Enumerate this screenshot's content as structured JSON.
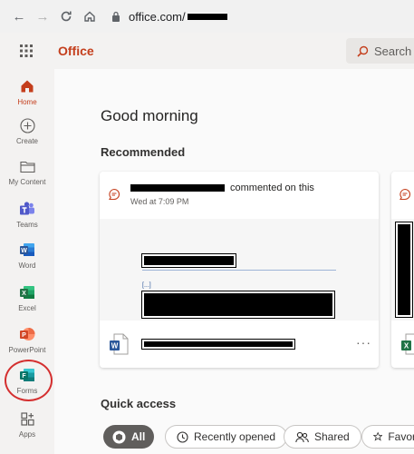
{
  "browser": {
    "url": "office.com/"
  },
  "header": {
    "brand": "Office",
    "search_placeholder": "Search"
  },
  "rail": {
    "items": [
      {
        "label": "Home"
      },
      {
        "label": "Create"
      },
      {
        "label": "My Content"
      },
      {
        "label": "Teams"
      },
      {
        "label": "Word"
      },
      {
        "label": "Excel"
      },
      {
        "label": "PowerPoint"
      },
      {
        "label": "Forms"
      },
      {
        "label": "Apps"
      }
    ]
  },
  "main": {
    "greeting": "Good morning",
    "recommended_title": "Recommended",
    "card": {
      "activity_text": "commented on this",
      "timestamp": "Wed at 7:09 PM",
      "preview_small": "[...]",
      "more": "···"
    },
    "quick_access": {
      "title": "Quick access",
      "chips": [
        {
          "label": "All"
        },
        {
          "label": "Recently opened"
        },
        {
          "label": "Shared"
        },
        {
          "label": "Favor"
        }
      ]
    }
  },
  "colors": {
    "accent": "#c43e1c",
    "word": "#2b579a",
    "excel": "#217346",
    "powerpoint": "#d24726",
    "forms": "#077568",
    "teams": "#5059c9",
    "circle": "#d42f2f"
  },
  "icons": [
    "back-icon",
    "forward-icon",
    "refresh-icon",
    "home-browser-icon",
    "lock-icon",
    "waffle-icon",
    "search-icon",
    "home-icon",
    "create-icon",
    "folder-icon",
    "teams-icon",
    "word-icon",
    "excel-icon",
    "powerpoint-icon",
    "forms-icon",
    "apps-icon",
    "comment-icon",
    "word-file-icon",
    "excel-file-icon",
    "clock-icon",
    "shared-icon",
    "star-icon"
  ]
}
